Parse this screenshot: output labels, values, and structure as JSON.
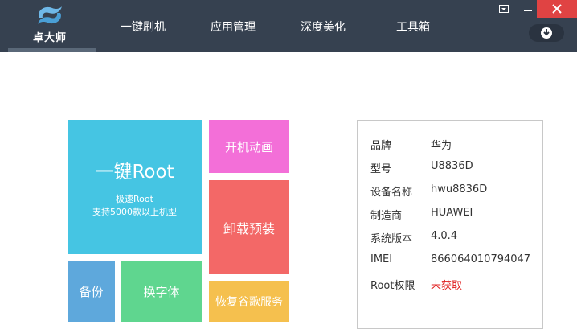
{
  "app": {
    "logo_text": "卓大师"
  },
  "nav": {
    "items": [
      {
        "label": "一键刷机"
      },
      {
        "label": "应用管理"
      },
      {
        "label": "深度美化"
      },
      {
        "label": "工具箱"
      }
    ]
  },
  "window_controls": {
    "dropdown_icon": "dropdown-icon",
    "minimize_icon": "minimize-icon",
    "close_icon": "close-icon",
    "download_icon": "download-icon"
  },
  "tiles": {
    "root": {
      "title": "一键Root",
      "line1": "极速Root",
      "line2": "支持5000款以上机型"
    },
    "boot_animation": {
      "label": "开机动画"
    },
    "uninstall": {
      "label": "卸载预装"
    },
    "backup": {
      "label": "备份"
    },
    "font": {
      "label": "换字体"
    },
    "google_services": {
      "label": "恢复谷歌服务"
    }
  },
  "device_info": {
    "rows": [
      {
        "label": "品牌",
        "value": "华为"
      },
      {
        "label": "型号",
        "value": "U8836D"
      },
      {
        "label": "设备名称",
        "value": "hwu8836D"
      },
      {
        "label": "制造商",
        "value": "HUAWEI"
      },
      {
        "label": "系统版本",
        "value": "4.0.4"
      },
      {
        "label": "IMEI",
        "value": "866064010794047"
      },
      {
        "label": "Root权限",
        "value": "未获取"
      }
    ]
  },
  "colors": {
    "topbar": "#364150",
    "root_tile": "#45c5e3",
    "boot_tile": "#f36fd8",
    "uninstall_tile": "#f36867",
    "backup_tile": "#5ea8dc",
    "font_tile": "#5fd68f",
    "google_tile": "#f5c04e",
    "root_status": "#e02020"
  }
}
